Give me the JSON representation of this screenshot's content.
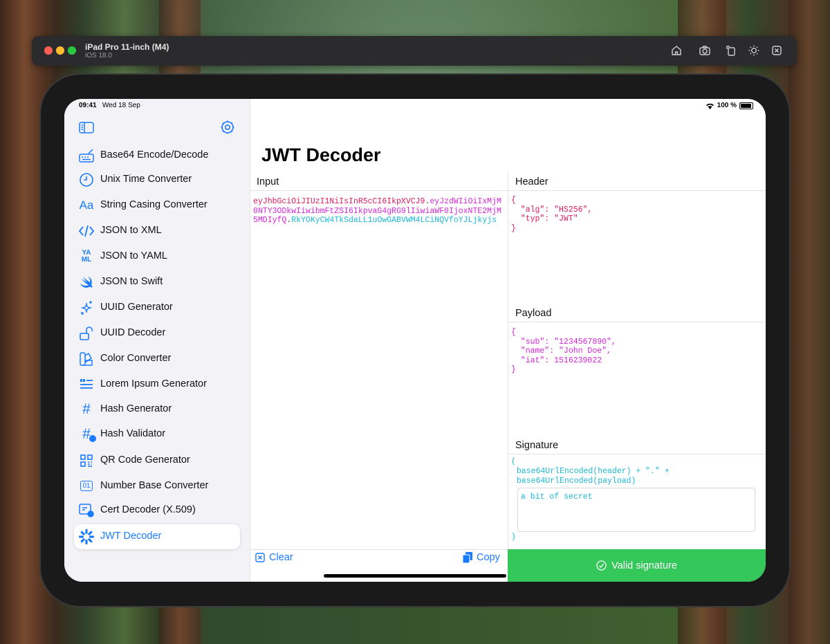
{
  "simulator": {
    "device_name": "iPad Pro 11-inch (M4)",
    "os_version": "iOS 18.0",
    "toolbar_icons": [
      "home-icon",
      "screenshot-icon",
      "rotate-icon",
      "appearance-icon",
      "side-button-icon"
    ]
  },
  "status_bar": {
    "time": "09:41",
    "date": "Wed 18 Sep",
    "battery": "100 %"
  },
  "sidebar": {
    "items": [
      {
        "label": "Base64 Encode/Decode",
        "icon": "keyboard-pen-icon"
      },
      {
        "label": "Unix Time Converter",
        "icon": "clock-icon"
      },
      {
        "label": "String Casing Converter",
        "icon": "text-case-icon"
      },
      {
        "label": "JSON to XML",
        "icon": "code-brackets-icon"
      },
      {
        "label": "JSON to YAML",
        "icon": "yaml-icon"
      },
      {
        "label": "JSON to Swift",
        "icon": "swift-icon"
      },
      {
        "label": "UUID Generator",
        "icon": "sparkles-icon"
      },
      {
        "label": "UUID Decoder",
        "icon": "unlock-icon"
      },
      {
        "label": "Color Converter",
        "icon": "swatch-icon"
      },
      {
        "label": "Lorem Ipsum Generator",
        "icon": "quote-text-icon"
      },
      {
        "label": "Hash Generator",
        "icon": "hash-icon"
      },
      {
        "label": "Hash Validator",
        "icon": "hash-check-icon"
      },
      {
        "label": "QR Code Generator",
        "icon": "qr-code-icon"
      },
      {
        "label": "Number Base Converter",
        "icon": "binary-icon"
      },
      {
        "label": "Cert Decoder (X.509)",
        "icon": "certificate-icon"
      },
      {
        "label": "JWT Decoder",
        "icon": "jwt-icon",
        "selected": true
      }
    ]
  },
  "main": {
    "title": "JWT Decoder",
    "input_label": "Input",
    "jwt": {
      "header_part": "eyJhbGciOiJIUzI1NiIsInR5cCI6IkpXVCJ9",
      "payload_part": "eyJzdWIiOiIxMjM0NTY3ODkwIiwibmFtZSI6IkpvaG4gRG9lIiwiaWF0IjoxNTE2MjM5MDIyfQ",
      "signature_part": "RkYOKyCW4TkSdaLL1uOwGABVWM4LCiNQVfoYJLjkyjs",
      "dot": "."
    },
    "header_label": "Header",
    "header_json": "{\n  \"alg\": \"HS256\",\n  \"typ\": \"JWT\"\n}",
    "payload_label": "Payload",
    "payload_json": "{\n  \"sub\": \"1234567890\",\n  \"name\": \"John Doe\",\n  \"iat\": 1516239022\n}",
    "signature_label": "Signature",
    "signature_open": "(",
    "signature_formula": " base64UrlEncoded(header) + \".\" +\n base64UrlEncoded(payload)",
    "signature_close": ")",
    "secret_value": "a bit of secret",
    "clear_label": "Clear",
    "copy_label": "Copy",
    "valid_label": "Valid signature"
  },
  "colors": {
    "accent": "#1a7bff",
    "header_color": "#e0195a",
    "payload_color": "#d526d9",
    "signature_color": "#1bb8d6",
    "valid_green": "#34c759"
  }
}
